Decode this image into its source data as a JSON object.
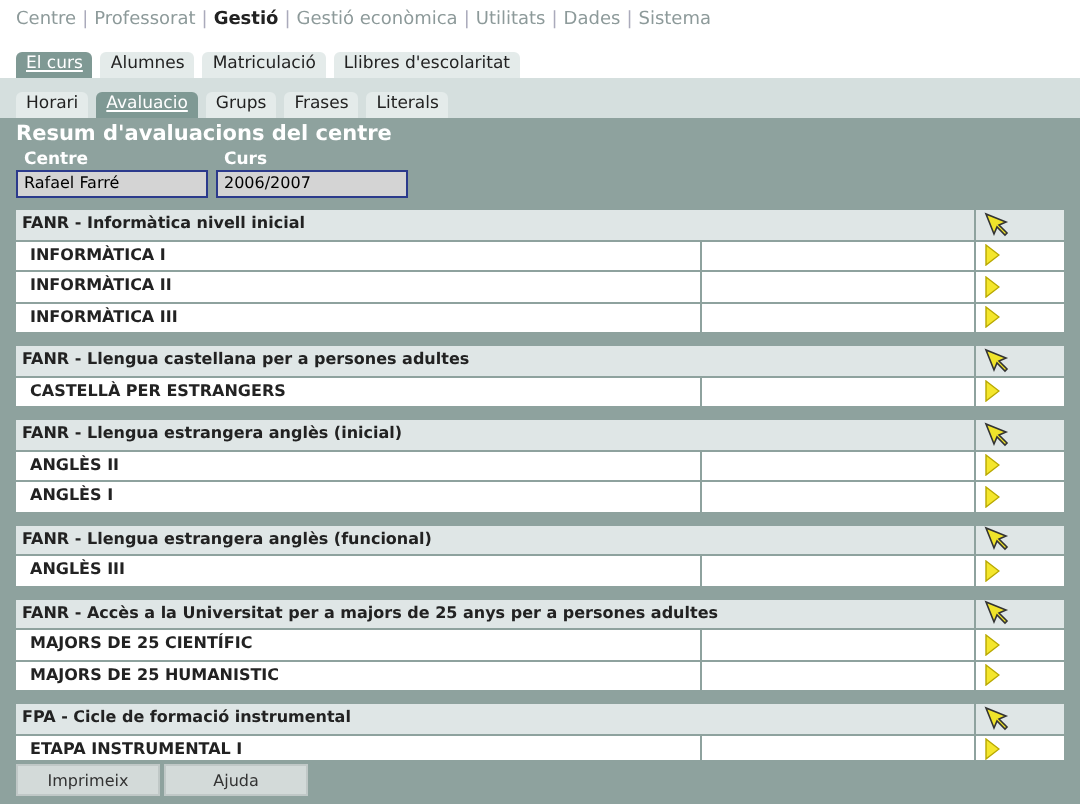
{
  "nav_separator": "|",
  "nav": [
    {
      "label": "Centre",
      "selected": false
    },
    {
      "label": "Professorat",
      "selected": false
    },
    {
      "label": "Gestió",
      "selected": true
    },
    {
      "label": "Gestió econòmica",
      "selected": false
    },
    {
      "label": "Utilitats",
      "selected": false
    },
    {
      "label": "Dades",
      "selected": false
    },
    {
      "label": "Sistema",
      "selected": false
    }
  ],
  "tabs": [
    {
      "label": "El curs",
      "selected": true
    },
    {
      "label": "Alumnes",
      "selected": false
    },
    {
      "label": "Matriculació",
      "selected": false
    },
    {
      "label": "Llibres d'escolaritat",
      "selected": false
    }
  ],
  "subtabs": [
    {
      "label": "Horari",
      "selected": false
    },
    {
      "label": "Avaluacio",
      "selected": true
    },
    {
      "label": "Grups",
      "selected": false
    },
    {
      "label": "Frases",
      "selected": false
    },
    {
      "label": "Literals",
      "selected": false
    }
  ],
  "title": "Resum d'avaluacions del centre",
  "fields": [
    {
      "label": "Centre",
      "value": "Rafael Farré"
    },
    {
      "label": "Curs",
      "value": "2006/2007"
    }
  ],
  "groups": [
    {
      "title": "FANR - Informàtica nivell inicial",
      "items": [
        "INFORMÀTICA I",
        "INFORMÀTICA II",
        "INFORMÀTICA III"
      ]
    },
    {
      "title": "FANR - Llengua castellana per a persones adultes",
      "items": [
        "CASTELLÀ PER ESTRANGERS"
      ]
    },
    {
      "title": "FANR - Llengua estrangera anglès (inicial)",
      "items": [
        "ANGLÈS II",
        "ANGLÈS I"
      ]
    },
    {
      "title": "FANR - Llengua estrangera anglès (funcional)",
      "items": [
        "ANGLÈS III"
      ]
    },
    {
      "title": "FANR - Accès a la Universitat per a majors de 25 anys per a persones adultes",
      "items": [
        "MAJORS DE 25 CIENTÍFIC",
        "MAJORS DE 25 HUMANISTIC"
      ]
    },
    {
      "title": "FPA - Cicle de formació instrumental",
      "items": [
        "ETAPA INSTRUMENTAL I"
      ]
    }
  ],
  "buttons": [
    "Imprimeix",
    "Ajuda"
  ]
}
